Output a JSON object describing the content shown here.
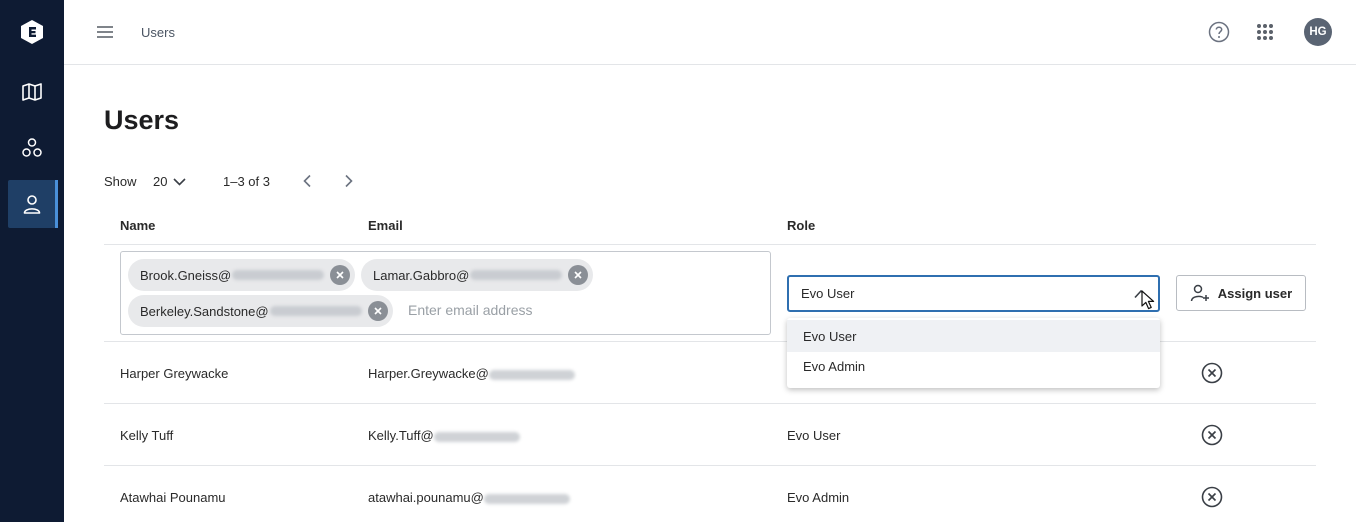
{
  "header": {
    "breadcrumb": "Users",
    "avatar_initials": "HG"
  },
  "page": {
    "title": "Users",
    "pagination": {
      "show_label": "Show",
      "page_size": "20",
      "range": "1–3 of 3"
    }
  },
  "table": {
    "columns": {
      "name": "Name",
      "email": "Email",
      "role": "Role"
    }
  },
  "invite": {
    "chips": [
      {
        "text": "Brook.Gneiss@"
      },
      {
        "text": "Lamar.Gabbro@"
      },
      {
        "text": "Berkeley.Sandstone@"
      }
    ],
    "email_placeholder": "Enter email address",
    "role_value": "Evo User",
    "role_options": [
      "Evo User",
      "Evo Admin"
    ],
    "assign_label": "Assign user"
  },
  "users": [
    {
      "name": "Harper Greywacke",
      "email": "Harper.Greywacke@",
      "role": ""
    },
    {
      "name": "Kelly Tuff",
      "email": "Kelly.Tuff@",
      "role": "Evo User"
    },
    {
      "name": "Atawhai Pounamu",
      "email": "atawhai.pounamu@",
      "role": "Evo Admin"
    }
  ],
  "colors": {
    "rail": "#0e1b33",
    "active_rail_item": "#1f3f66",
    "focus_border": "#2f6fb0"
  }
}
